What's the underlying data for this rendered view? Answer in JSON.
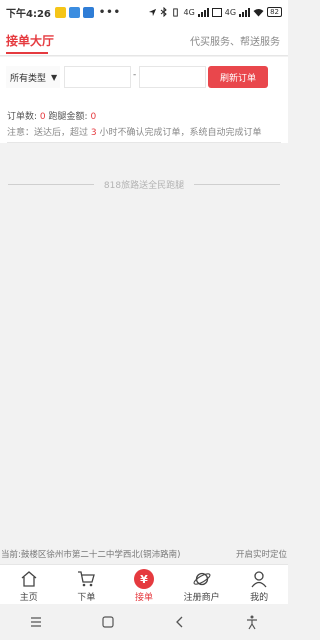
{
  "status_bar": {
    "time": "下午4:26",
    "dots": "•••",
    "net1": "4G",
    "net2": "4G",
    "battery": "82",
    "app_colors": [
      "#f5c518",
      "#3b8de0",
      "#2f7dd6"
    ]
  },
  "header": {
    "title": "接单大厅",
    "links": "代买服务、帮送服务"
  },
  "filter": {
    "type_select": "所有类型",
    "date_from": "",
    "date_separator": "-",
    "date_to": "",
    "refresh_button": "刷新订单"
  },
  "stats": {
    "order_count_label": "订单数:",
    "order_count": "0",
    "amount_label": "跑腿金额:",
    "amount": "0"
  },
  "notice": {
    "prefix": "注意：送达后，超过",
    "hours": "3",
    "suffix": "小时不确认完成订单，系统自动完成订单"
  },
  "slogan": "818旅路送全民跑腿",
  "location": {
    "text": "当前:鼓楼区徐州市第二十二中学西北(铜沛路南)",
    "button": "开启实时定位"
  },
  "tabs": [
    {
      "label": "主页",
      "icon": "home-icon"
    },
    {
      "label": "下单",
      "icon": "cart-icon"
    },
    {
      "label": "接单",
      "icon": "yen-icon",
      "glyph": "¥"
    },
    {
      "label": "注册商户",
      "icon": "planet-icon"
    },
    {
      "label": "我的",
      "icon": "user-icon"
    }
  ],
  "colors": {
    "accent": "#e53a3f",
    "button": "#e9474c",
    "background": "#f2f2f2"
  }
}
